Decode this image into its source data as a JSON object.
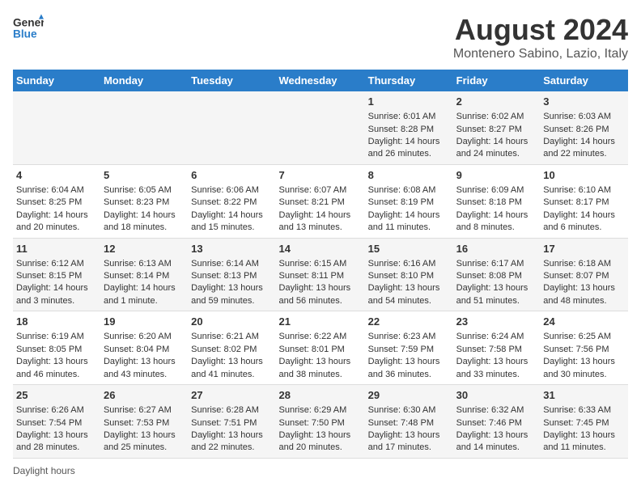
{
  "header": {
    "logo_line1": "General",
    "logo_line2": "Blue",
    "main_title": "August 2024",
    "subtitle": "Montenero Sabino, Lazio, Italy"
  },
  "days_of_week": [
    "Sunday",
    "Monday",
    "Tuesday",
    "Wednesday",
    "Thursday",
    "Friday",
    "Saturday"
  ],
  "weeks": [
    [
      {
        "day": "",
        "content": ""
      },
      {
        "day": "",
        "content": ""
      },
      {
        "day": "",
        "content": ""
      },
      {
        "day": "",
        "content": ""
      },
      {
        "day": "1",
        "content": "Sunrise: 6:01 AM\nSunset: 8:28 PM\nDaylight: 14 hours and 26 minutes."
      },
      {
        "day": "2",
        "content": "Sunrise: 6:02 AM\nSunset: 8:27 PM\nDaylight: 14 hours and 24 minutes."
      },
      {
        "day": "3",
        "content": "Sunrise: 6:03 AM\nSunset: 8:26 PM\nDaylight: 14 hours and 22 minutes."
      }
    ],
    [
      {
        "day": "4",
        "content": "Sunrise: 6:04 AM\nSunset: 8:25 PM\nDaylight: 14 hours and 20 minutes."
      },
      {
        "day": "5",
        "content": "Sunrise: 6:05 AM\nSunset: 8:23 PM\nDaylight: 14 hours and 18 minutes."
      },
      {
        "day": "6",
        "content": "Sunrise: 6:06 AM\nSunset: 8:22 PM\nDaylight: 14 hours and 15 minutes."
      },
      {
        "day": "7",
        "content": "Sunrise: 6:07 AM\nSunset: 8:21 PM\nDaylight: 14 hours and 13 minutes."
      },
      {
        "day": "8",
        "content": "Sunrise: 6:08 AM\nSunset: 8:19 PM\nDaylight: 14 hours and 11 minutes."
      },
      {
        "day": "9",
        "content": "Sunrise: 6:09 AM\nSunset: 8:18 PM\nDaylight: 14 hours and 8 minutes."
      },
      {
        "day": "10",
        "content": "Sunrise: 6:10 AM\nSunset: 8:17 PM\nDaylight: 14 hours and 6 minutes."
      }
    ],
    [
      {
        "day": "11",
        "content": "Sunrise: 6:12 AM\nSunset: 8:15 PM\nDaylight: 14 hours and 3 minutes."
      },
      {
        "day": "12",
        "content": "Sunrise: 6:13 AM\nSunset: 8:14 PM\nDaylight: 14 hours and 1 minute."
      },
      {
        "day": "13",
        "content": "Sunrise: 6:14 AM\nSunset: 8:13 PM\nDaylight: 13 hours and 59 minutes."
      },
      {
        "day": "14",
        "content": "Sunrise: 6:15 AM\nSunset: 8:11 PM\nDaylight: 13 hours and 56 minutes."
      },
      {
        "day": "15",
        "content": "Sunrise: 6:16 AM\nSunset: 8:10 PM\nDaylight: 13 hours and 54 minutes."
      },
      {
        "day": "16",
        "content": "Sunrise: 6:17 AM\nSunset: 8:08 PM\nDaylight: 13 hours and 51 minutes."
      },
      {
        "day": "17",
        "content": "Sunrise: 6:18 AM\nSunset: 8:07 PM\nDaylight: 13 hours and 48 minutes."
      }
    ],
    [
      {
        "day": "18",
        "content": "Sunrise: 6:19 AM\nSunset: 8:05 PM\nDaylight: 13 hours and 46 minutes."
      },
      {
        "day": "19",
        "content": "Sunrise: 6:20 AM\nSunset: 8:04 PM\nDaylight: 13 hours and 43 minutes."
      },
      {
        "day": "20",
        "content": "Sunrise: 6:21 AM\nSunset: 8:02 PM\nDaylight: 13 hours and 41 minutes."
      },
      {
        "day": "21",
        "content": "Sunrise: 6:22 AM\nSunset: 8:01 PM\nDaylight: 13 hours and 38 minutes."
      },
      {
        "day": "22",
        "content": "Sunrise: 6:23 AM\nSunset: 7:59 PM\nDaylight: 13 hours and 36 minutes."
      },
      {
        "day": "23",
        "content": "Sunrise: 6:24 AM\nSunset: 7:58 PM\nDaylight: 13 hours and 33 minutes."
      },
      {
        "day": "24",
        "content": "Sunrise: 6:25 AM\nSunset: 7:56 PM\nDaylight: 13 hours and 30 minutes."
      }
    ],
    [
      {
        "day": "25",
        "content": "Sunrise: 6:26 AM\nSunset: 7:54 PM\nDaylight: 13 hours and 28 minutes."
      },
      {
        "day": "26",
        "content": "Sunrise: 6:27 AM\nSunset: 7:53 PM\nDaylight: 13 hours and 25 minutes."
      },
      {
        "day": "27",
        "content": "Sunrise: 6:28 AM\nSunset: 7:51 PM\nDaylight: 13 hours and 22 minutes."
      },
      {
        "day": "28",
        "content": "Sunrise: 6:29 AM\nSunset: 7:50 PM\nDaylight: 13 hours and 20 minutes."
      },
      {
        "day": "29",
        "content": "Sunrise: 6:30 AM\nSunset: 7:48 PM\nDaylight: 13 hours and 17 minutes."
      },
      {
        "day": "30",
        "content": "Sunrise: 6:32 AM\nSunset: 7:46 PM\nDaylight: 13 hours and 14 minutes."
      },
      {
        "day": "31",
        "content": "Sunrise: 6:33 AM\nSunset: 7:45 PM\nDaylight: 13 hours and 11 minutes."
      }
    ]
  ],
  "footer": {
    "label": "Daylight hours"
  }
}
